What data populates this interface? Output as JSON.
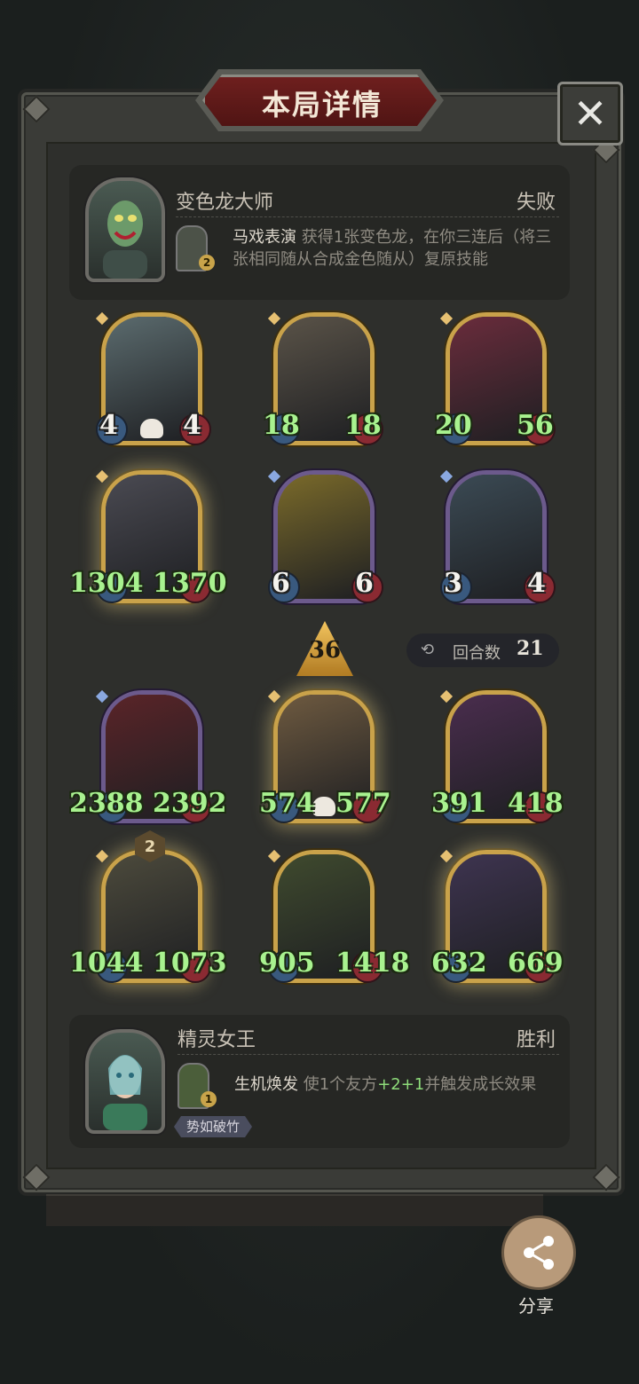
{
  "dialog": {
    "title": "本局详情",
    "close_icon": "close-icon"
  },
  "opponent": {
    "name": "变色龙大师",
    "result": "失败",
    "skill_level": "2",
    "skill_name": "马戏表演",
    "skill_desc": "获得1张变色龙，在你三连后（将三张相同随从合成金色随从）复原技能"
  },
  "opponent_board": [
    {
      "atk": "4",
      "hp": "4",
      "skull": true,
      "frame": "gold",
      "art": "#5b6b6e"
    },
    {
      "atk": "18",
      "hp": "18",
      "skull": false,
      "frame": "gold",
      "art": "#5a5348"
    },
    {
      "atk": "20",
      "hp": "56",
      "skull": false,
      "frame": "gold",
      "art": "#6a2c3c"
    },
    {
      "atk": "1304",
      "hp": "1370",
      "skull": false,
      "frame": "gold-glow",
      "art": "#4a4a52"
    },
    {
      "atk": "6",
      "hp": "6",
      "skull": false,
      "frame": "purple",
      "art": "#7a6a2a"
    },
    {
      "atk": "3",
      "hp": "4",
      "skull": false,
      "frame": "purple",
      "art": "#3b4a54"
    }
  ],
  "battle": {
    "damage": "36",
    "round_label": "回合数",
    "round_value": "21"
  },
  "player_board": [
    {
      "atk": "2388",
      "hp": "2392",
      "skull": false,
      "frame": "purple",
      "art": "#5a2428"
    },
    {
      "atk": "574",
      "hp": "577",
      "skull": true,
      "frame": "gold-glow",
      "art": "#6e5a40"
    },
    {
      "atk": "391",
      "hp": "418",
      "skull": false,
      "frame": "gold",
      "art": "#4a2d4e"
    },
    {
      "atk": "1044",
      "hp": "1073",
      "skull": false,
      "frame": "gold-glow",
      "art": "#4c4a3c",
      "tier": "2"
    },
    {
      "atk": "905",
      "hp": "1418",
      "skull": false,
      "frame": "gold",
      "art": "#3f4a2e"
    },
    {
      "atk": "632",
      "hp": "669",
      "skull": false,
      "frame": "gold-glow",
      "art": "#3e3450"
    }
  ],
  "player": {
    "name": "精灵女王",
    "result": "胜利",
    "skill_level": "1",
    "skill_name": "生机焕发",
    "skill_desc_1": "使1个友方",
    "skill_desc_hl": "+2+1",
    "skill_desc_2": "并触发成长效果",
    "tag": "势如破竹"
  },
  "share": {
    "label": "分享",
    "icon": "share-icon"
  }
}
